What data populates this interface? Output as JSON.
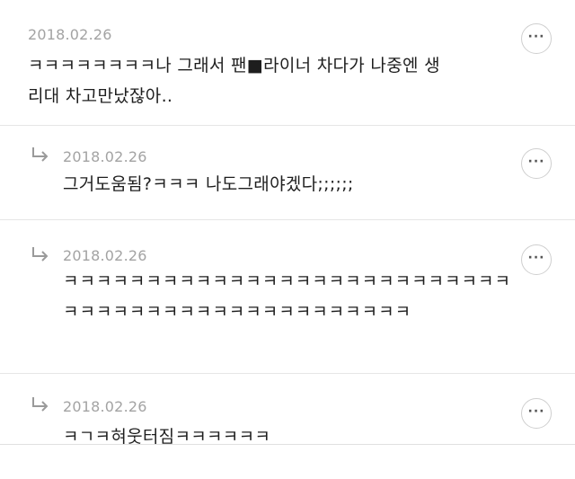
{
  "comments": [
    {
      "date": "2018.02.26",
      "line1": "ㅋㅋㅋㅋㅋㅋㅋㅋ나 그래서 팬■라이너 차다가 나중엔 생",
      "line2": "리대 차고만났잖아..",
      "more_label": "···",
      "is_reply": false
    },
    {
      "date": "2018.02.26",
      "line1": "그거도움됨?ㅋㅋㅋ 나도그래야겠다;;;;;;",
      "more_label": "···",
      "is_reply": true
    },
    {
      "date": "2018.02.26",
      "line1": "ㅋㅋㅋㅋㅋㅋㅋㅋㅋㅋㅋㅋㅋㅋㅋㅋㅋㅋㅋㅋㅋㅋㅋㅋㅋㅋㅋ",
      "line2": "ㅋㅋㅋㅋㅋㅋㅋㅋㅋㅋㅋㅋㅋㅋㅋㅋㅋㅋㅋㅋㅋ",
      "more_label": "···",
      "is_reply": true
    },
    {
      "date": "2018.02.26",
      "line1": "ㅋㄱㅋ혀웃터짐ㅋㅋㅋㅋㅋㅋ",
      "more_label": "···",
      "is_reply": true
    }
  ],
  "icons": {
    "reply": "reply-arrow-icon",
    "more": "more-options-icon"
  }
}
